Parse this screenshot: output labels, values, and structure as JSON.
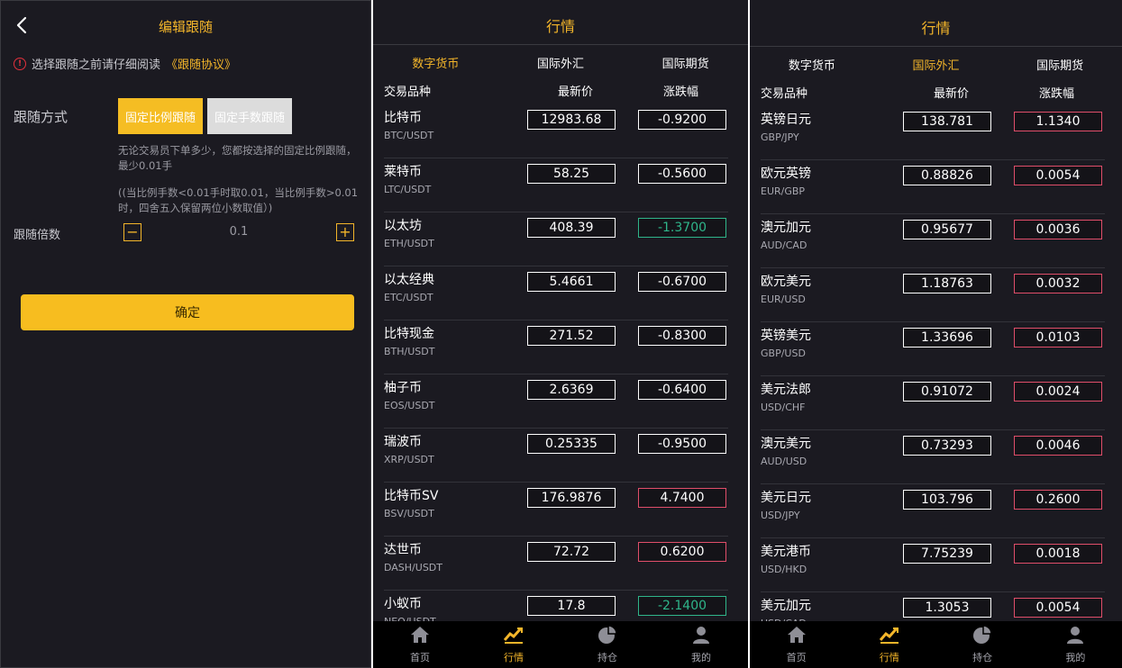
{
  "follow_edit": {
    "title": "编辑跟随",
    "notice_text": "选择跟随之前请仔细阅读",
    "notice_link": "《跟随协议》",
    "mode_label": "跟随方式",
    "mode_options": [
      "固定比例跟随",
      "固定手数跟随"
    ],
    "mode_selected": "固定比例跟随",
    "desc_line1": "无论交易员下单多少，您都按选择的固定比例跟随，最少0.01手",
    "desc_line2": "((当比例手数<0.01手时取0.01，当比例手数>0.01时，四舍五入保留两位小数取值）)",
    "multiplier_label": "跟随倍数",
    "multiplier_value": "0.1",
    "confirm_label": "确定"
  },
  "market_crypto": {
    "title": "行情",
    "tabs": [
      "数字货币",
      "国际外汇",
      "国际期货"
    ],
    "active_tab": "数字货币",
    "headers": [
      "交易品种",
      "最新价",
      "涨跌幅"
    ],
    "rows": [
      {
        "name": "比特币",
        "code": "BTC/USDT",
        "price": "12983.68",
        "change": "-0.9200",
        "style": "white"
      },
      {
        "name": "莱特币",
        "code": "LTC/USDT",
        "price": "58.25",
        "change": "-0.5600",
        "style": "white"
      },
      {
        "name": "以太坊",
        "code": "ETH/USDT",
        "price": "408.39",
        "change": "-1.3700",
        "style": "green"
      },
      {
        "name": "以太经典",
        "code": "ETC/USDT",
        "price": "5.4661",
        "change": "-0.6700",
        "style": "white"
      },
      {
        "name": "比特现金",
        "code": "BTH/USDT",
        "price": "271.52",
        "change": "-0.8300",
        "style": "white"
      },
      {
        "name": "柚子币",
        "code": "EOS/USDT",
        "price": "2.6369",
        "change": "-0.6400",
        "style": "white"
      },
      {
        "name": "瑞波币",
        "code": "XRP/USDT",
        "price": "0.25335",
        "change": "-0.9500",
        "style": "white"
      },
      {
        "name": "比特币SV",
        "code": "BSV/USDT",
        "price": "176.9876",
        "change": "4.7400",
        "style": "red"
      },
      {
        "name": "达世币",
        "code": "DASH/USDT",
        "price": "72.72",
        "change": "0.6200",
        "style": "red"
      },
      {
        "name": "小蚁币",
        "code": "NEO/USDT",
        "price": "17.8",
        "change": "-2.1400",
        "style": "green"
      }
    ]
  },
  "market_forex": {
    "title": "行情",
    "tabs": [
      "数字货币",
      "国际外汇",
      "国际期货"
    ],
    "active_tab": "国际外汇",
    "headers": [
      "交易品种",
      "最新价",
      "涨跌幅"
    ],
    "rows": [
      {
        "name": "英镑日元",
        "code": "GBP/JPY",
        "price": "138.781",
        "change": "1.1340",
        "style": "red"
      },
      {
        "name": "欧元英镑",
        "code": "EUR/GBP",
        "price": "0.88826",
        "change": "0.0054",
        "style": "red"
      },
      {
        "name": "澳元加元",
        "code": "AUD/CAD",
        "price": "0.95677",
        "change": "0.0036",
        "style": "red"
      },
      {
        "name": "欧元美元",
        "code": "EUR/USD",
        "price": "1.18763",
        "change": "0.0032",
        "style": "red"
      },
      {
        "name": "英镑美元",
        "code": "GBP/USD",
        "price": "1.33696",
        "change": "0.0103",
        "style": "red"
      },
      {
        "name": "美元法郎",
        "code": "USD/CHF",
        "price": "0.91072",
        "change": "0.0024",
        "style": "red"
      },
      {
        "name": "澳元美元",
        "code": "AUD/USD",
        "price": "0.73293",
        "change": "0.0046",
        "style": "red"
      },
      {
        "name": "美元日元",
        "code": "USD/JPY",
        "price": "103.796",
        "change": "0.2600",
        "style": "red"
      },
      {
        "name": "美元港币",
        "code": "USD/HKD",
        "price": "7.75239",
        "change": "0.0018",
        "style": "red"
      },
      {
        "name": "美元加元",
        "code": "USD/CAD",
        "price": "1.3053",
        "change": "0.0054",
        "style": "red"
      }
    ]
  },
  "bottom_nav": {
    "items": [
      {
        "label": "首页",
        "icon": "home-icon"
      },
      {
        "label": "行情",
        "icon": "market-chart-icon"
      },
      {
        "label": "持仓",
        "icon": "position-pie-icon"
      },
      {
        "label": "我的",
        "icon": "profile-icon"
      }
    ],
    "active": "行情"
  },
  "colors": {
    "accent": "#f3b52a",
    "background": "#1b1a21",
    "up_border": "#e04e6a",
    "down_green": "#2fb58a"
  }
}
